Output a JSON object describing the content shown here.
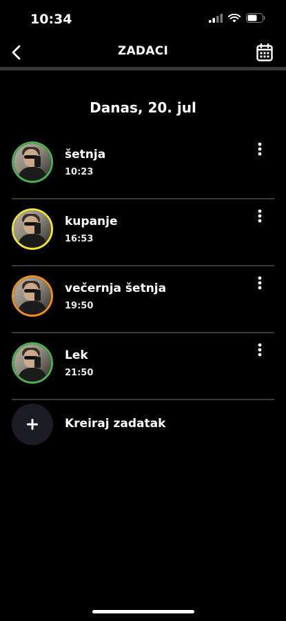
{
  "status_bar": {
    "time": "10:34"
  },
  "header": {
    "title": "ZADACI",
    "back_icon": "chevron-left-icon",
    "calendar_icon": "calendar-icon"
  },
  "section": {
    "title": "Danas, 20. jul"
  },
  "tasks": [
    {
      "title": "šetnja",
      "time": "10:23",
      "ring_color": "#4caf50"
    },
    {
      "title": "kupanje",
      "time": "16:53",
      "ring_color": "#f1e33a"
    },
    {
      "title": "večernja šetnja",
      "time": "19:50",
      "ring_color": "#f0901e"
    },
    {
      "title": "Lek",
      "time": "21:50",
      "ring_color": "#4caf50"
    }
  ],
  "create": {
    "label": "Kreiraj zadatak",
    "icon": "plus-icon"
  },
  "colors": {
    "background": "#000000",
    "divider": "#3a3a3c",
    "create_circle": "#1c1c24"
  }
}
